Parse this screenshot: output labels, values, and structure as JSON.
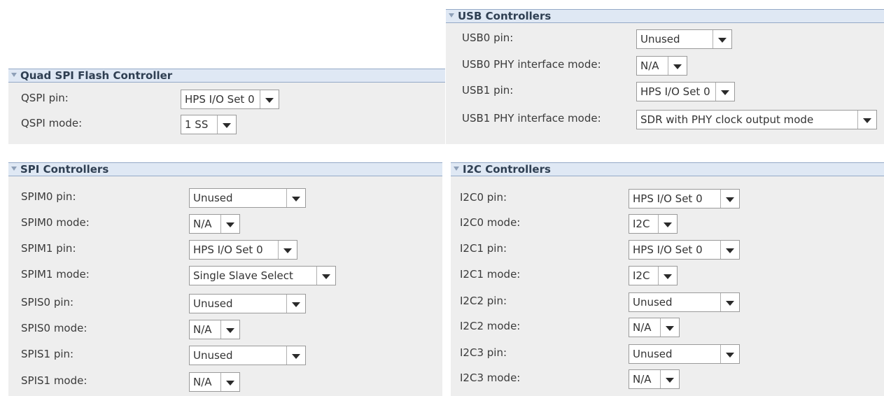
{
  "usb": {
    "title": "USB Controllers",
    "rows": [
      {
        "label": "USB0 pin:",
        "value": "Unused"
      },
      {
        "label": "USB0 PHY interface mode:",
        "value": "N/A"
      },
      {
        "label": "USB1 pin:",
        "value": "HPS I/O Set 0"
      },
      {
        "label": "USB1 PHY interface mode:",
        "value": "SDR with PHY clock output mode"
      }
    ]
  },
  "qspi": {
    "title": "Quad SPI Flash Controller",
    "rows": [
      {
        "label": "QSPI pin:",
        "value": "HPS I/O Set 0"
      },
      {
        "label": "QSPI mode:",
        "value": "1 SS"
      }
    ]
  },
  "spi": {
    "title": "SPI Controllers",
    "rows": [
      {
        "label": "SPIM0 pin:",
        "value": "Unused"
      },
      {
        "label": "SPIM0 mode:",
        "value": "N/A"
      },
      {
        "label": "SPIM1 pin:",
        "value": "HPS I/O Set 0"
      },
      {
        "label": "SPIM1 mode:",
        "value": "Single Slave Select"
      },
      {
        "label": "SPIS0 pin:",
        "value": "Unused"
      },
      {
        "label": "SPIS0 mode:",
        "value": "N/A"
      },
      {
        "label": "SPIS1 pin:",
        "value": "Unused"
      },
      {
        "label": "SPIS1 mode:",
        "value": "N/A"
      }
    ]
  },
  "i2c": {
    "title": "I2C Controllers",
    "rows": [
      {
        "label": "I2C0 pin:",
        "value": "HPS I/O Set 0"
      },
      {
        "label": "I2C0 mode:",
        "value": "I2C"
      },
      {
        "label": "I2C1 pin:",
        "value": "HPS I/O Set 0"
      },
      {
        "label": "I2C1 mode:",
        "value": "I2C"
      },
      {
        "label": "I2C2 pin:",
        "value": "Unused"
      },
      {
        "label": "I2C2 mode:",
        "value": "N/A"
      },
      {
        "label": "I2C3 pin:",
        "value": "Unused"
      },
      {
        "label": "I2C3 mode:",
        "value": "N/A"
      }
    ]
  }
}
